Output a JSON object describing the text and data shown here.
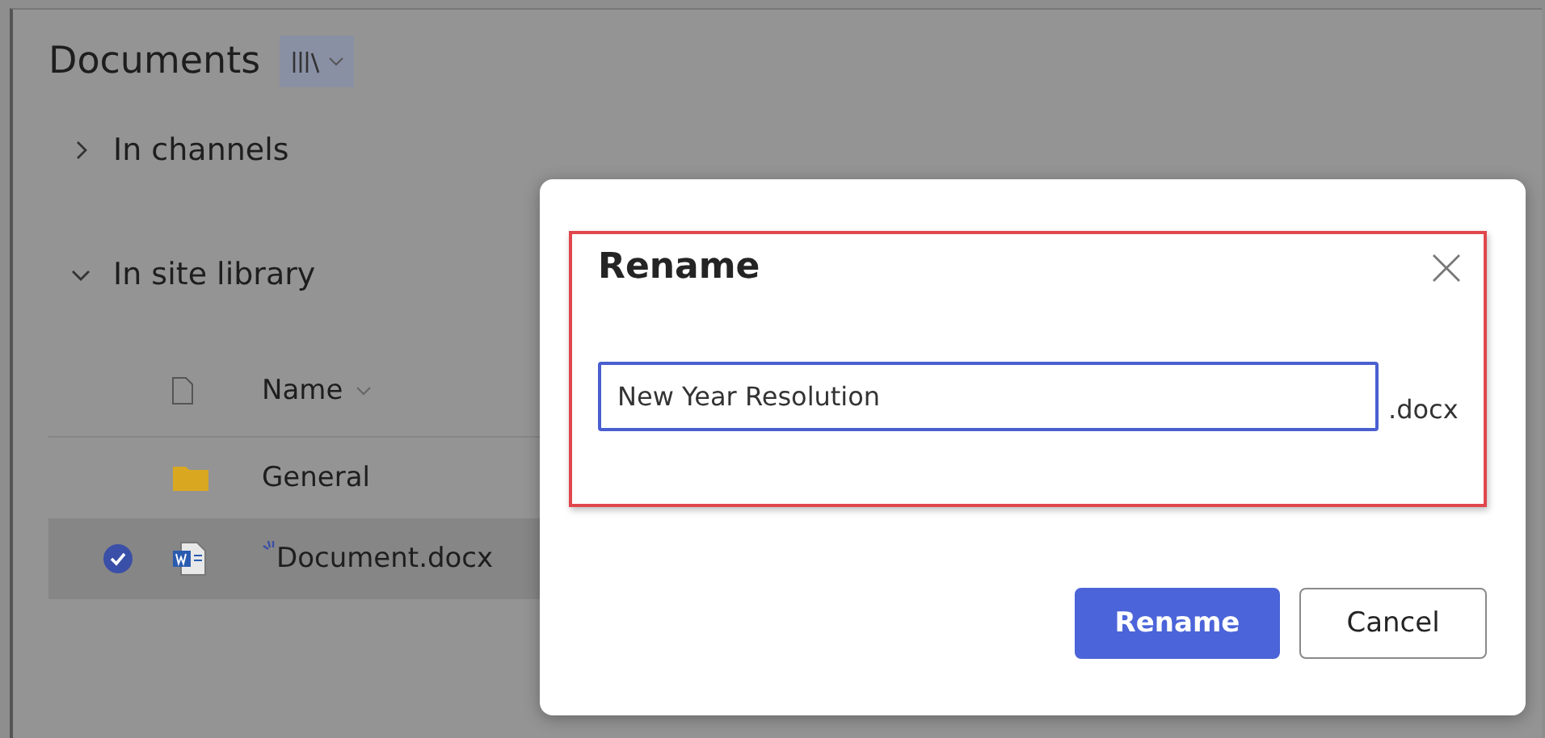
{
  "header": {
    "title": "Documents"
  },
  "sections": [
    {
      "label": "In channels",
      "expanded": false
    },
    {
      "label": "In site library",
      "expanded": true
    }
  ],
  "table": {
    "columns": [
      "Name"
    ],
    "rows": [
      {
        "kind": "folder",
        "name": "General",
        "selected": false,
        "syncing": false
      },
      {
        "kind": "word",
        "name": "Document.docx",
        "selected": true,
        "syncing": true
      }
    ]
  },
  "dialog": {
    "title": "Rename",
    "value": "New Year Resolution",
    "extension": ".docx",
    "highlighted": true,
    "buttons": [
      {
        "label": "Rename",
        "primary": true
      },
      {
        "label": "Cancel",
        "primary": false
      }
    ]
  }
}
